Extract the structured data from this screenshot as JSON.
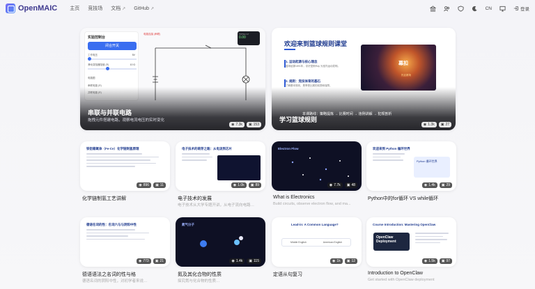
{
  "header": {
    "logo": "OpenMAIC",
    "nav": [
      {
        "label": "主页",
        "external": false
      },
      {
        "label": "竞技场",
        "external": false
      },
      {
        "label": "文档",
        "external": true
      },
      {
        "label": "GitHub",
        "external": true
      }
    ],
    "lang": "CN",
    "login": "登录"
  },
  "featured": [
    {
      "title": "串联与并联电路",
      "subtitle": "拖拽元件搭建电路，观察电流电压的实时变化",
      "views": "7.3k",
      "saves": "153",
      "panel": {
        "title": "实验控制台",
        "button": "闭合开关",
        "slider1_label": "工作电压",
        "slider1_value": "5V",
        "slider2_label": "滑动变阻器阻值 (R)",
        "slider2_value": "10 Ω",
        "options_title": "电路图",
        "option1": "串联电路 (R)",
        "option2": "并联电路 (R)"
      },
      "meter": {
        "label": "TOTAL I.V",
        "value": "0.00"
      },
      "tag": "电路连接 (串联)"
    },
    {
      "title": "学习篮球规则",
      "views": "1.3k",
      "saves": "27",
      "heading": "欢迎来到篮球规则课堂",
      "items": [
        {
          "title": "1. 运动起源与核心理念",
          "text": "篮球起源1891年，奈史密斯Ray 为室内运动发明。"
        },
        {
          "title": "2. 规则：竞技体育的基石",
          "text": "了解基本规则，是享受比赛的前提和保障。"
        }
      ],
      "photo_text": "幕扣",
      "photo_caption": "热血赛场",
      "flow": "本课路线：策略提炼 → 比赛时间 → 违例讲解 → 犯规剖析"
    }
  ],
  "cards": [
    {
      "title": "化学链制氢工艺讲解",
      "subtitle": "",
      "views": "896",
      "saves": "11",
      "thumb_head": "铁铝载氧体（Fe-Ce）化学链制氢原理",
      "dark": false
    },
    {
      "title": "电子技术的发展",
      "subtitle": "电子技术从大学专题开讲，从电子流向电路…",
      "views": "1.0k",
      "saves": "89",
      "thumb_head": "电子技术的萌芽之路：从电流到芯片",
      "dark": false
    },
    {
      "title": "What is Electronics",
      "subtitle": "Build circuits, observe electron flow, and ma...",
      "views": "7.7k",
      "saves": "48",
      "thumb_head": "Electron Flow",
      "dark": true
    },
    {
      "title": "Python中的for循环 VS while循环",
      "subtitle": "",
      "views": "1.4k",
      "saves": "29",
      "thumb_head": "欢迎来到 Python 循环世界",
      "dark": false
    },
    {
      "title": "德语语法之名词的性与格",
      "subtitle": "德语名词的阴阳中性，对初学者来说…",
      "views": "773",
      "saves": "21",
      "thumb_head": "德语名词的性：名词六与与阴阳中性",
      "dark": false
    },
    {
      "title": "氮及其化合物的性质",
      "subtitle": "探究氮与化合物的性质…",
      "views": "1.4k",
      "saves": "115",
      "thumb_head": "氮气分子",
      "dark": true
    },
    {
      "title": "定语从句复习",
      "subtitle": "",
      "views": "1k",
      "saves": "12",
      "thumb_head": "Lead-in: A Common Language?",
      "dark": false
    },
    {
      "title": "Introduction to OpenClaw",
      "subtitle": "Get started with OpenClaw deployment",
      "views": "1.5k",
      "saves": "97",
      "thumb_head": "Course Introduction: Mastering OpenClaw",
      "dark": false
    }
  ],
  "thumb_extra": {
    "openclaw_box": "OpenClaw Deployment",
    "english_left": "Middle English",
    "english_right": "American English",
    "python_banner": "Python 循环世界"
  },
  "colors": {
    "accent": "#3a6ef0",
    "brand": "#3f3a8f"
  }
}
